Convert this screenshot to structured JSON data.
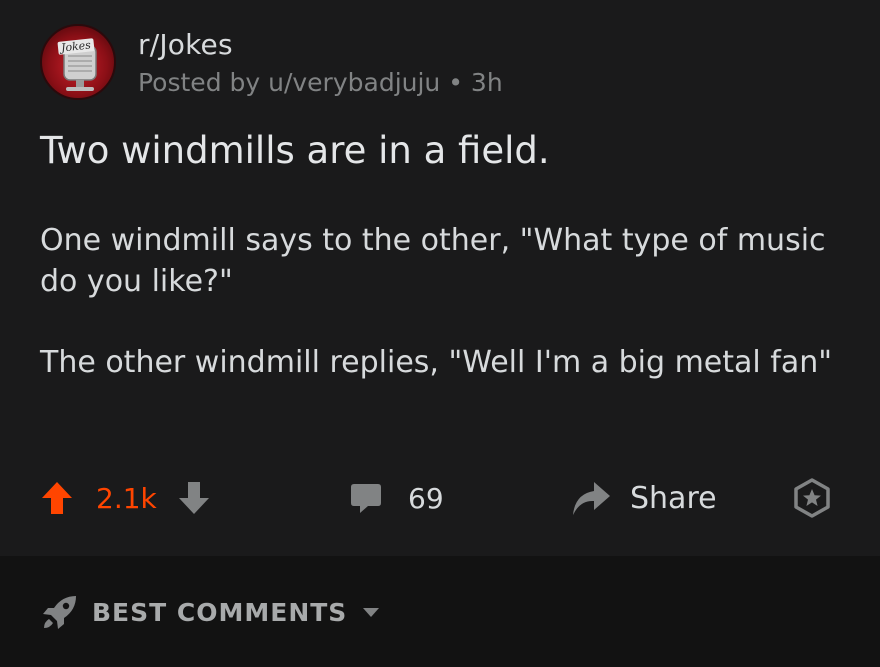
{
  "post": {
    "subreddit": "r/Jokes",
    "posted_by": "Posted by u/verybadjuju • 3h",
    "avatar_text": "Jokes",
    "title": "Two windmills are in a field.",
    "body": [
      "One windmill says to the other, \"What type of music do you like?\"",
      "The other windmill replies, \"Well I'm a big metal fan\""
    ]
  },
  "actions": {
    "score": "2.1k",
    "comment_count": "69",
    "share_label": "Share"
  },
  "comments_sort": {
    "label": "BEST COMMENTS"
  },
  "icons": {
    "upvote": "upvote-arrow-icon",
    "downvote": "downvote-arrow-icon",
    "comment": "comment-bubble-icon",
    "share": "share-arrow-icon",
    "award": "award-icon",
    "sort": "rocket-icon",
    "dropdown": "chevron-down-icon"
  },
  "colors": {
    "background": "#121212",
    "post_background": "#1a1a1b",
    "upvote_active": "#ff4500",
    "text_primary": "#d7dadc",
    "text_muted": "#818384"
  }
}
